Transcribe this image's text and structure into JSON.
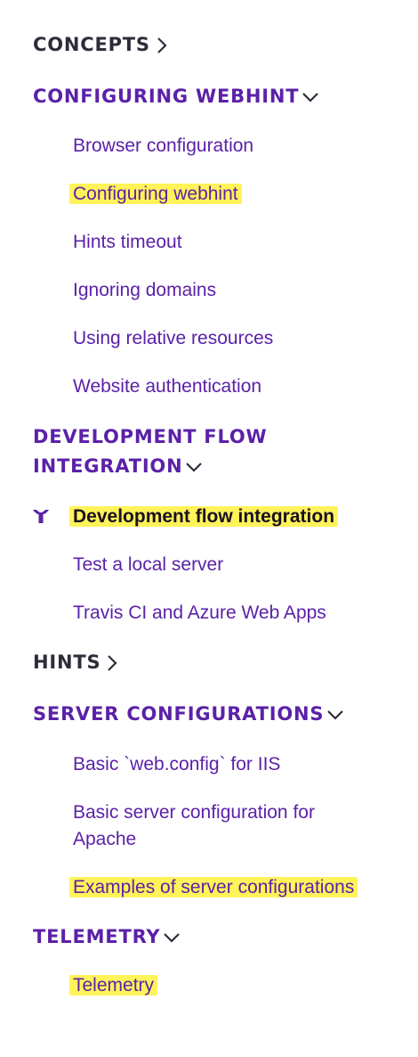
{
  "nav": {
    "concepts": {
      "label": "CONCEPTS",
      "state": "collapsed"
    },
    "configuring_webhint": {
      "label": "CONFIGURING WEBHINT",
      "state": "expanded",
      "items": [
        "Browser configuration",
        "Configuring webhint",
        "Hints timeout",
        "Ignoring domains",
        "Using relative resources",
        "Website authentication"
      ]
    },
    "development_flow": {
      "label_line1": "DEVELOPMENT FLOW",
      "label_line2": "INTEGRATION",
      "state": "expanded",
      "items": [
        "Development flow integration",
        "Test a local server",
        "Travis CI and Azure Web Apps"
      ]
    },
    "hints": {
      "label": "HINTS",
      "state": "collapsed"
    },
    "server_configurations": {
      "label": "SERVER CONFIGURATIONS",
      "state": "expanded",
      "items": [
        "Basic `web.config` for IIS",
        "Basic server configuration for Apache",
        "Examples of server configurations"
      ]
    },
    "telemetry": {
      "label": "TELEMETRY",
      "state": "expanded",
      "items": [
        "Telemetry"
      ]
    }
  },
  "icons": {
    "current_page": "current-page-pointer-icon"
  },
  "colors": {
    "link": "#5b21a8",
    "section_collapsed": "#2d2d3a",
    "highlight": "#fff35a"
  }
}
